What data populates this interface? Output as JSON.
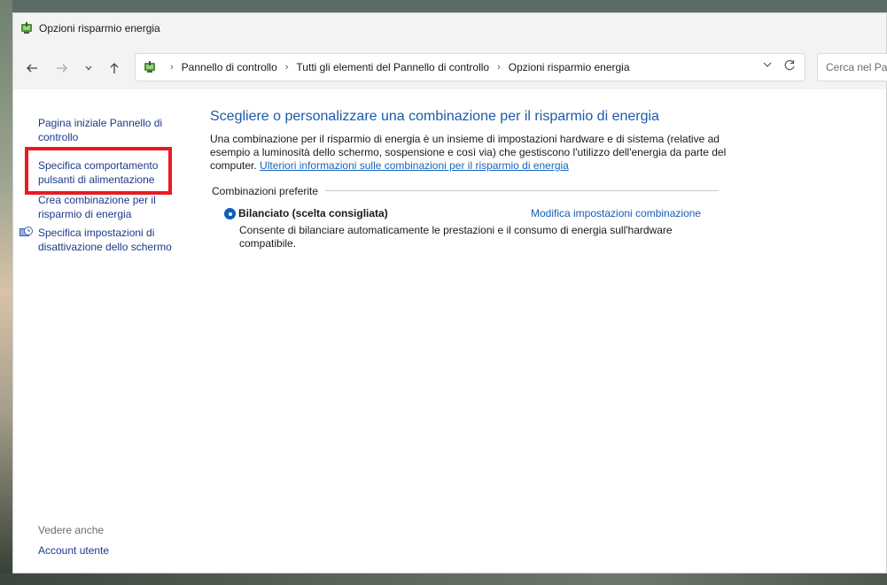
{
  "window": {
    "title": "Opzioni risparmio energia"
  },
  "address_bar": {
    "crumbs": [
      "Pannello di controllo",
      "Tutti gli elementi del Pannello di controllo",
      "Opzioni risparmio energia"
    ],
    "separator": "›"
  },
  "search": {
    "placeholder": "Cerca nel Pannello di controllo"
  },
  "sidebar": {
    "items": [
      {
        "label": "Pagina iniziale Pannello di controllo"
      },
      {
        "label": "Specifica comportamento pulsanti di alimentazione"
      },
      {
        "label": "Crea combinazione per il risparmio di energia"
      },
      {
        "label": "Specifica impostazioni di disattivazione dello schermo"
      }
    ],
    "see_also_label": "Vedere anche",
    "account_link": "Account utente"
  },
  "main": {
    "heading": "Scegliere o personalizzare una combinazione per il risparmio di energia",
    "description": "Una combinazione per il risparmio di energia è un insieme di impostazioni hardware e di sistema (relative ad esempio a luminosità dello schermo, sospensione e così via) che gestiscono l'utilizzo dell'energia da parte del computer.",
    "description_link": "Ulteriori informazioni sulle combinazioni per il risparmio di energia",
    "group_label": "Combinazioni preferite",
    "plan": {
      "name": "Bilanciato (scelta consigliata)",
      "edit_link": "Modifica impostazioni combinazione",
      "description": "Consente di bilanciare automaticamente le prestazioni e il consumo di energia sull'hardware compatibile."
    }
  },
  "colors": {
    "link": "#1c3a8a",
    "heading": "#1e5aa8",
    "highlight": "#e81b23"
  }
}
